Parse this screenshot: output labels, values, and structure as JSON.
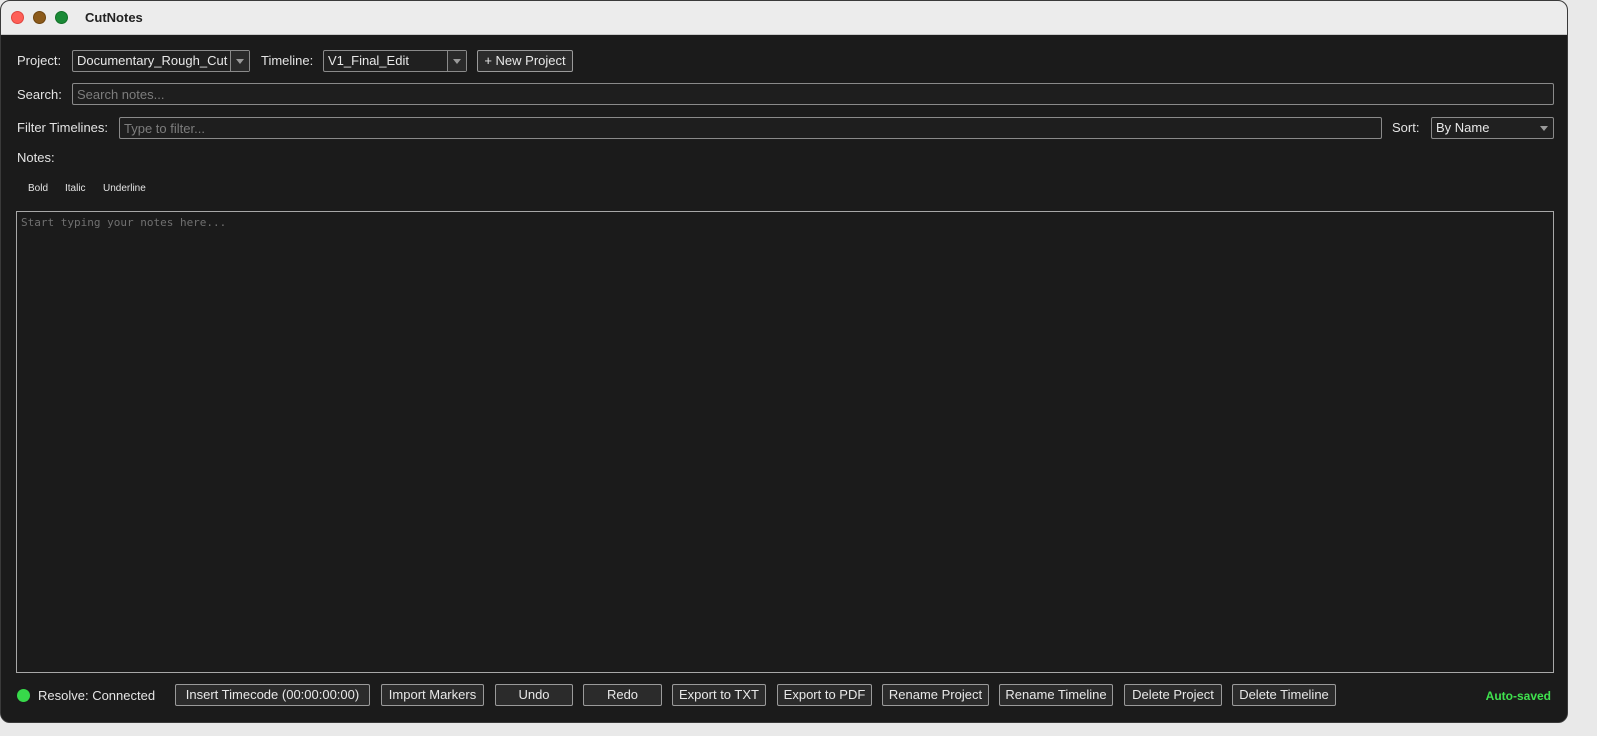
{
  "window": {
    "title": "CutNotes"
  },
  "project": {
    "label": "Project:",
    "selected": "Documentary_Rough_Cut"
  },
  "timeline": {
    "label": "Timeline:",
    "selected": "V1_Final_Edit"
  },
  "new_project_button": "+ New Project",
  "search": {
    "label": "Search:",
    "placeholder": "Search notes..."
  },
  "filter": {
    "label": "Filter Timelines:",
    "placeholder": "Type to filter..."
  },
  "sort": {
    "label": "Sort:",
    "selected": "By Name"
  },
  "notes": {
    "label": "Notes:",
    "placeholder": "Start typing your notes here..."
  },
  "formatting": {
    "bold": "Bold",
    "italic": "Italic",
    "underline": "Underline"
  },
  "status": {
    "resolve": "Resolve: Connected",
    "autosave": "Auto-saved"
  },
  "actions": {
    "insert_timecode": "Insert Timecode (00:00:00:00)",
    "import_markers": "Import Markers",
    "undo": "Undo",
    "redo": "Redo",
    "export_txt": "Export to TXT",
    "export_pdf": "Export to PDF",
    "rename_project": "Rename Project",
    "rename_timeline": "Rename Timeline",
    "delete_project": "Delete Project",
    "delete_timeline": "Delete Timeline"
  },
  "colors": {
    "background": "#1b1b1b",
    "status_green": "#37d94a",
    "autosave_green": "#3fe24e"
  }
}
